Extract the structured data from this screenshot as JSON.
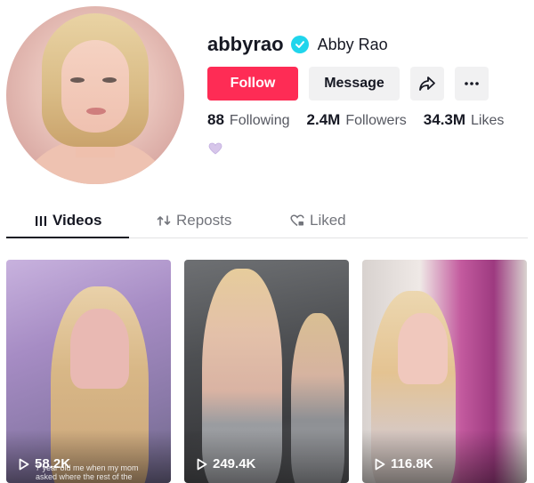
{
  "profile": {
    "username": "abbyrao",
    "nickname": "Abby Rao",
    "follow_label": "Follow",
    "message_label": "Message",
    "verified": true,
    "bio_emoji": "💜"
  },
  "stats": [
    {
      "value": "88",
      "label": "Following"
    },
    {
      "value": "2.4M",
      "label": "Followers"
    },
    {
      "value": "34.3M",
      "label": "Likes"
    }
  ],
  "tabs": [
    {
      "label": "Videos",
      "icon": "grid-icon",
      "active": true
    },
    {
      "label": "Reposts",
      "icon": "repost-icon",
      "active": false
    },
    {
      "label": "Liked",
      "icon": "heart-icon",
      "active": false
    }
  ],
  "videos": [
    {
      "views": "58.2K",
      "caption": "7 year old me when my mom asked where the rest of the"
    },
    {
      "views": "249.4K",
      "caption": ""
    },
    {
      "views": "116.8K",
      "caption": ""
    }
  ],
  "colors": {
    "accent": "#fe2c55",
    "verified": "#20d5ec",
    "text_primary": "#161823",
    "text_secondary": "#73757c"
  }
}
